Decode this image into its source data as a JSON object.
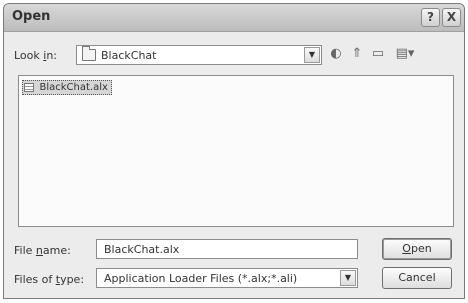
{
  "window": {
    "title": "Open",
    "help_glyph": "?",
    "close_glyph": "X"
  },
  "look_in": {
    "label_prefix": "Look ",
    "label_underlined": "i",
    "label_suffix": "n:",
    "value": "BlackChat",
    "icon": "folder-icon"
  },
  "toolbar": {
    "back_icon": "back-arrow-icon",
    "up_icon": "up-folder-icon",
    "new_folder_icon": "new-folder-icon",
    "view_icon": "view-menu-icon",
    "back_glyph": "◐",
    "up_glyph": "⇑",
    "new_folder_glyph": "▭",
    "view_glyph": "▤▾"
  },
  "files": [
    {
      "name": "BlackChat.alx",
      "selected": true,
      "icon": "document-icon"
    }
  ],
  "file_name": {
    "label_prefix": "File ",
    "label_underlined": "n",
    "label_suffix": "ame:",
    "value": "BlackChat.alx"
  },
  "file_type": {
    "label_prefix": "Files of ",
    "label_underlined": "t",
    "label_suffix": "ype:",
    "value": "Application Loader Files (*.alx;*.ali)"
  },
  "buttons": {
    "open_underlined": "O",
    "open_rest": "pen",
    "cancel_label": "Cancel"
  },
  "colors": {
    "dialog_background": "#ececec",
    "selection_background": "#d6d6d6"
  }
}
